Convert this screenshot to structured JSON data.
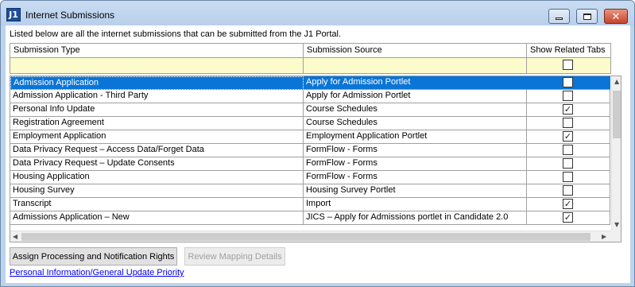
{
  "window": {
    "title": "Internet Submissions",
    "app_icon_text": "J1"
  },
  "description": "Listed below are all the internet submissions that can be submitted from the J1 Portal.",
  "columns": {
    "type": "Submission Type",
    "source": "Submission Source",
    "tabs": "Show Related Tabs"
  },
  "filter": {
    "show_related_tabs_checked": false
  },
  "rows": [
    {
      "type": "Admission Application",
      "source": "Apply for Admission Portlet",
      "checked": false,
      "selected": true
    },
    {
      "type": "Admission Application - Third Party",
      "source": "Apply for Admission Portlet",
      "checked": false,
      "selected": false
    },
    {
      "type": "Personal Info Update",
      "source": "Course Schedules",
      "checked": true,
      "selected": false
    },
    {
      "type": "Registration Agreement",
      "source": "Course Schedules",
      "checked": false,
      "selected": false
    },
    {
      "type": "Employment Application",
      "source": "Employment Application Portlet",
      "checked": true,
      "selected": false
    },
    {
      "type": "Data Privacy Request – Access Data/Forget Data",
      "source": "FormFlow - Forms",
      "checked": false,
      "selected": false
    },
    {
      "type": "Data Privacy Request – Update Consents",
      "source": "FormFlow - Forms",
      "checked": false,
      "selected": false
    },
    {
      "type": "Housing Application",
      "source": "FormFlow - Forms",
      "checked": false,
      "selected": false
    },
    {
      "type": "Housing Survey",
      "source": "Housing Survey Portlet",
      "checked": false,
      "selected": false
    },
    {
      "type": "Transcript",
      "source": "Import",
      "checked": true,
      "selected": false
    },
    {
      "type": "Admissions Application – New",
      "source": "JICS – Apply for Admissions portlet in Candidate 2.0",
      "checked": true,
      "selected": false
    }
  ],
  "buttons": {
    "assign": "Assign Processing and Notification Rights",
    "review": "Review Mapping Details"
  },
  "link": "Personal Information/General Update Priority"
}
